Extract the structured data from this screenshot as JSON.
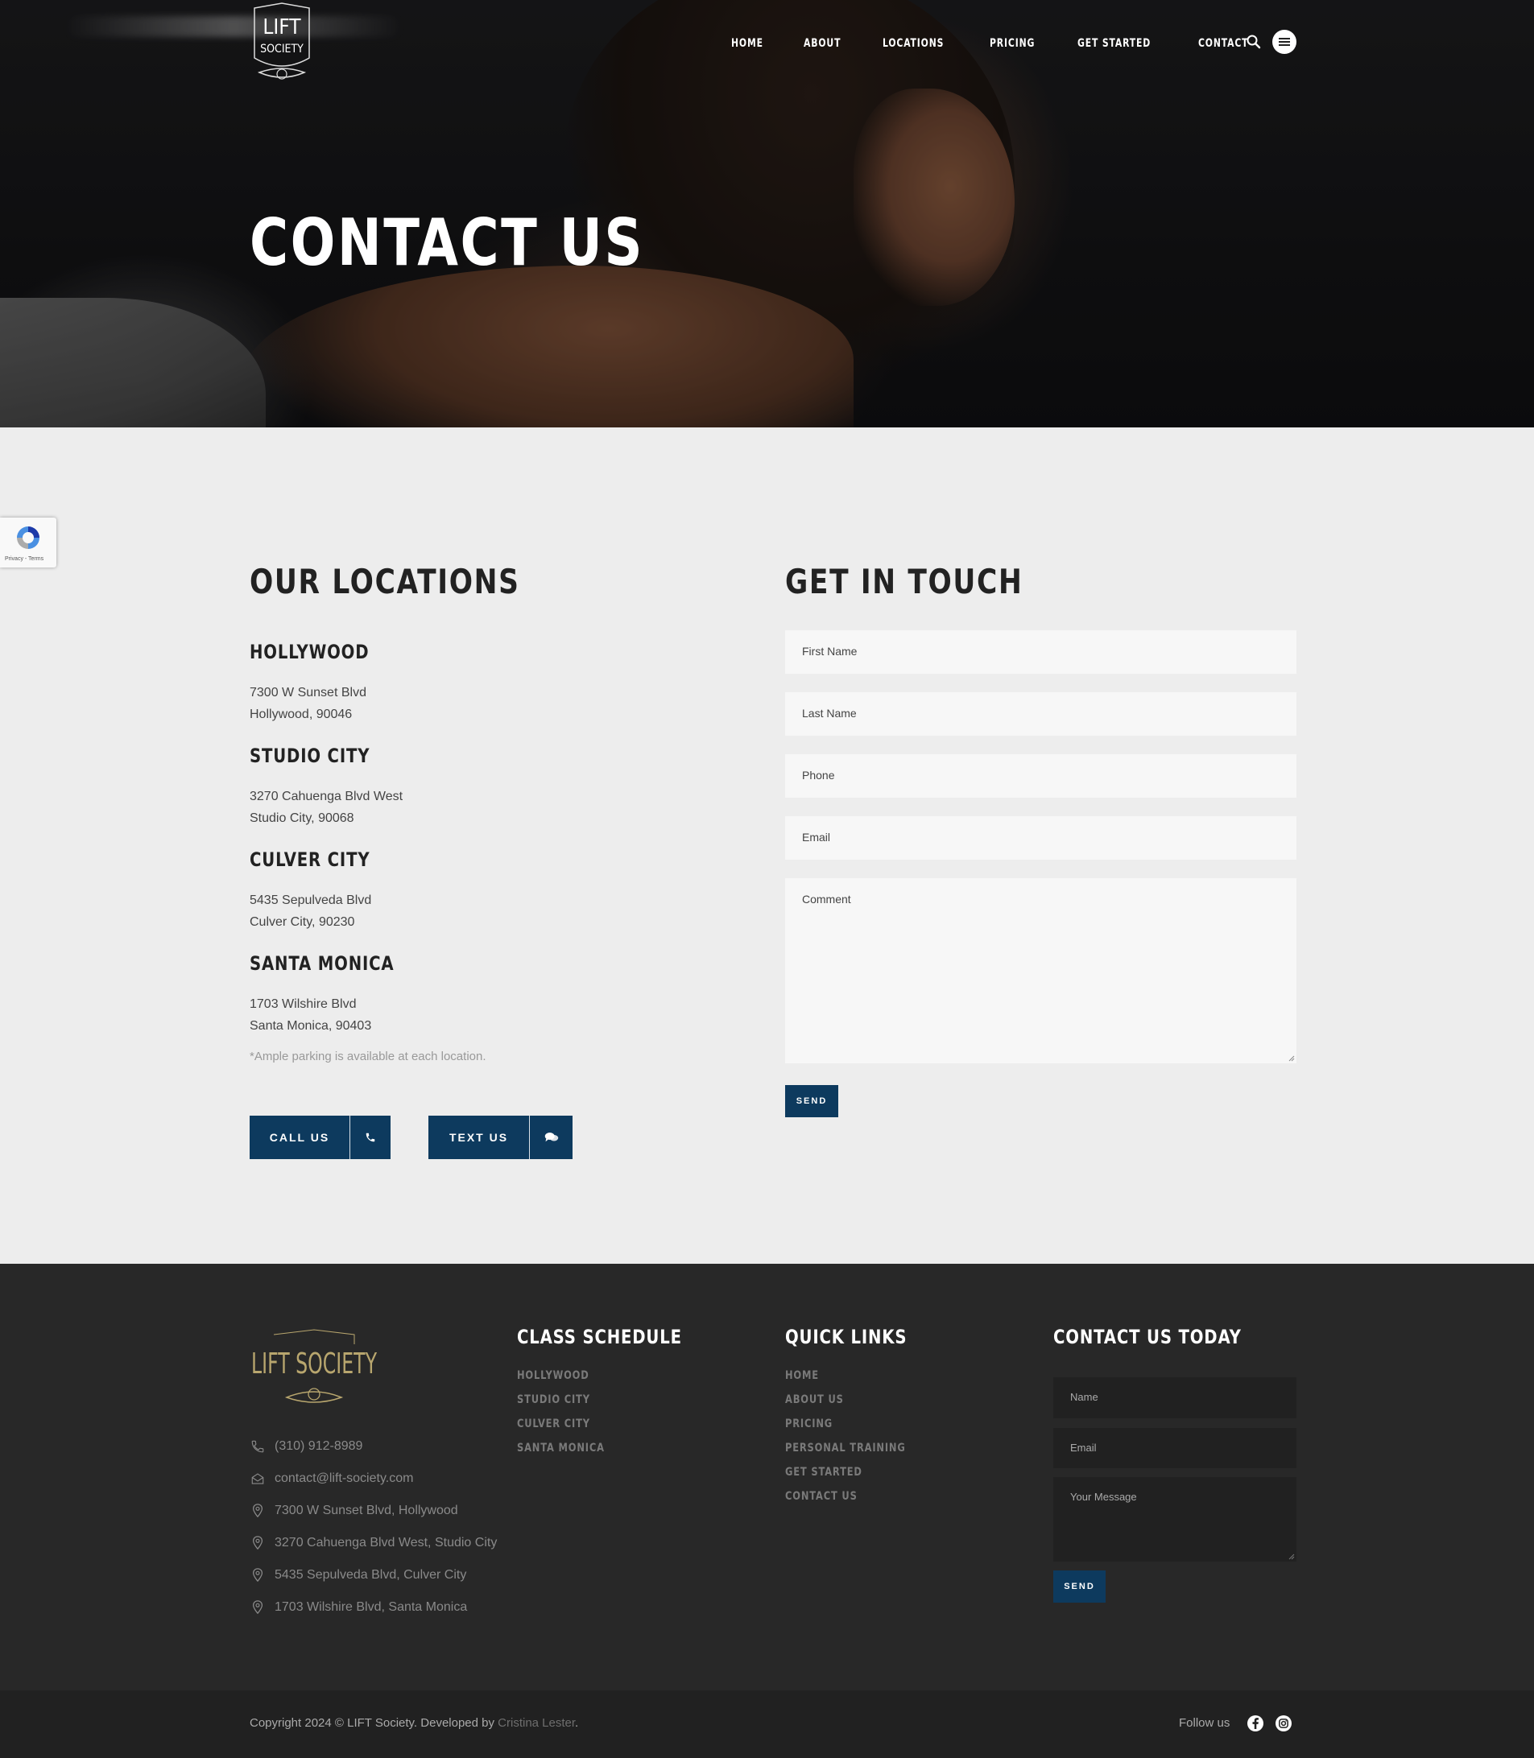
{
  "brand": {
    "logo_line1": "LIFT",
    "logo_line2": "SOCIETY",
    "footer_logo": "LIFT SOCIETY"
  },
  "nav": {
    "items": [
      "HOME",
      "ABOUT",
      "LOCATIONS",
      "PRICING",
      "GET STARTED",
      "CONTACT"
    ],
    "search_icon": "search-icon",
    "menu_icon": "hamburger-menu-icon"
  },
  "hero": {
    "title": "CONTACT US"
  },
  "recaptcha": {
    "text": "Privacy - Terms"
  },
  "locations": {
    "title": "OUR LOCATIONS",
    "items": [
      {
        "name": "HOLLYWOOD",
        "line1": "7300 W Sunset Blvd",
        "line2": "Hollywood, 90046"
      },
      {
        "name": "STUDIO CITY",
        "line1": "3270 Cahuenga Blvd West",
        "line2": "Studio City, 90068"
      },
      {
        "name": "CULVER CITY",
        "line1": "5435 Sepulveda Blvd",
        "line2": "Culver City, 90230"
      },
      {
        "name": "SANTA MONICA",
        "line1": "1703 Wilshire Blvd",
        "line2": "Santa Monica, 90403"
      }
    ],
    "parking_note": "*Ample parking is available at each location.",
    "call_label": "CALL US",
    "text_label": "TEXT US"
  },
  "contact_form": {
    "title": "GET IN TOUCH",
    "first_name": "First Name",
    "last_name": "Last Name",
    "phone": "Phone",
    "email": "Email",
    "comment": "Comment",
    "send": "SEND"
  },
  "footer": {
    "contacts": {
      "phone": "(310) 912-8989",
      "email": "contact@lift-society.com",
      "addr1": "7300 W Sunset Blvd, Hollywood",
      "addr2": "3270 Cahuenga Blvd West, Studio City",
      "addr3": "5435 Sepulveda Blvd, Culver City",
      "addr4": "1703 Wilshire Blvd, Santa Monica"
    },
    "schedule": {
      "title": "CLASS SCHEDULE",
      "links": [
        "HOLLYWOOD",
        "STUDIO CITY",
        "CULVER CITY",
        "SANTA MONICA"
      ]
    },
    "quick_links": {
      "title": "QUICK LINKS",
      "links": [
        "HOME",
        "ABOUT US",
        "PRICING",
        "PERSONAL TRAINING",
        "GET STARTED",
        "CONTACT US"
      ]
    },
    "contact_today": {
      "title": "CONTACT US TODAY",
      "name": "Name",
      "email": "Email",
      "message": "Your Message",
      "send": "SEND"
    },
    "copyright": "Copyright 2024 © LIFT Society.   Developed by ",
    "developer": "Cristina Lester",
    "period": ".",
    "follow": "Follow us"
  },
  "colors": {
    "accent": "#0d3a5e",
    "footer_bg": "#282828",
    "page_bg": "#ededed",
    "logo_gold": "#b8a66e"
  }
}
